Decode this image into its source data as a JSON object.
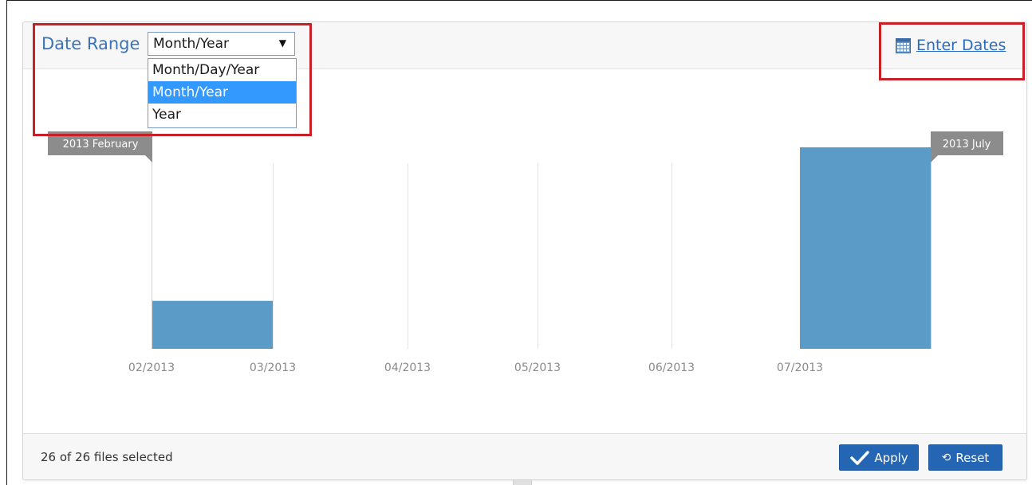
{
  "header": {
    "date_range_label": "Date Range",
    "select": {
      "value": "Month/Year",
      "options": [
        {
          "label": "Month/Day/Year",
          "selected": false
        },
        {
          "label": "Month/Year",
          "selected": true
        },
        {
          "label": "Year",
          "selected": false
        }
      ]
    },
    "enter_dates_label": "Enter Dates",
    "enter_dates_icon": "calendar-icon"
  },
  "chart_data": {
    "type": "bar",
    "categories": [
      "02/2013",
      "03/2013",
      "04/2013",
      "05/2013",
      "06/2013",
      "07/2013"
    ],
    "values": [
      5,
      0,
      0,
      0,
      0,
      21
    ],
    "ylim": [
      0,
      21
    ],
    "range_start_label": "2013 February",
    "range_end_label": "2013 July",
    "grid": "vertical",
    "bar_color": "#5b9bc8"
  },
  "footer": {
    "files_selected": "26 of 26 files selected",
    "apply_label": "Apply",
    "reset_label": "Reset",
    "apply_icon": "check-icon",
    "reset_icon": "undo-icon"
  },
  "colors": {
    "accent": "#2466b4",
    "highlight": "#c82027",
    "link": "#2a6cc0",
    "dropdown_selected": "#3399ff"
  }
}
